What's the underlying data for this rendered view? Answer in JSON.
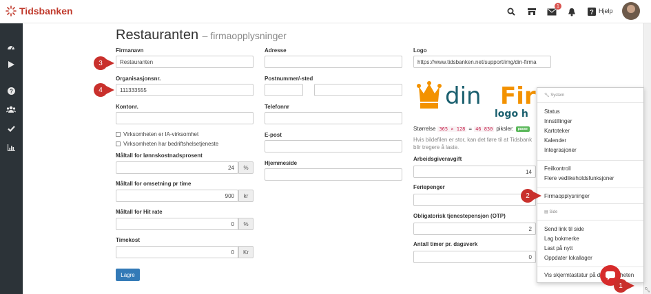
{
  "app": {
    "name": "Tidsbanken"
  },
  "topbar": {
    "help_label": "Hjelp",
    "mail_badge": "1",
    "icons": [
      "search-icon",
      "store-icon",
      "mail-icon",
      "bell-icon",
      "help-icon"
    ]
  },
  "sidebar": {
    "icons": [
      "dashboard-icon",
      "play-icon",
      "question-icon",
      "users-icon",
      "check-icon",
      "chart-icon"
    ]
  },
  "page": {
    "title": "Restauranten",
    "subtitle": "– firmaopplysninger"
  },
  "form": {
    "col1": {
      "firmanavn_label": "Firmanavn",
      "firmanavn_value": "Restauranten",
      "orgnr_label": "Organisasjonsnr.",
      "orgnr_value": "111333555",
      "kontonr_label": "Kontonr.",
      "kontonr_value": "",
      "check_ia": "Virksomheten er IA-virksomhet",
      "check_bht": "Virksomheten har bedriftshelsetjeneste",
      "lonn_label": "Måltall for lønnskostnadsprosent",
      "lonn_value": "24",
      "lonn_unit": "%",
      "oms_label": "Måltall for omsetning pr time",
      "oms_value": "900",
      "oms_unit": "kr",
      "hit_label": "Måltall for Hit rate",
      "hit_value": "0",
      "hit_unit": "%",
      "timekost_label": "Timekost",
      "timekost_value": "0",
      "timekost_unit": "Kr"
    },
    "col2": {
      "adresse_label": "Adresse",
      "post_label": "Postnummer/-sted",
      "telefon_label": "Telefonnr",
      "epost_label": "E-post",
      "hjemmeside_label": "Hjemmeside"
    },
    "col3": {
      "logo_label": "Logo",
      "logo_url": "https://www.tidsbanken.net/support/img/din-firma",
      "logo_text_din": "din",
      "logo_text_firma": "Firma",
      "logo_text_sub": "logo h",
      "size_label": "Størrelse",
      "size_w_h": "365 × 128",
      "size_eq": "=",
      "size_px": "46 830",
      "size_suffix": "piksler:",
      "size_status": "passe",
      "hint": "Hvis bildefilen er stor, kan det føre til at Tidsbank blir tregere å laste.",
      "aga_label": "Arbeidsgiveravgift",
      "aga_value": "14",
      "ferie_label": "Feriepenger",
      "otp_label": "Obligatorisk tjenestepensjon (OTP)",
      "otp_value": "2",
      "timer_label": "Antall timer pr. dagsverk",
      "timer_value": "0"
    },
    "save_label": "Lagre"
  },
  "menu": {
    "system_header": "System",
    "system_items": [
      "Status",
      "Innstillinger",
      "Kartoteker",
      "Kalender",
      "Integrasjoner"
    ],
    "maint_items": [
      "Feilkontroll",
      "Flere vedlikeholdsfunksjoner"
    ],
    "firma_item": "Firmaopplysninger",
    "side_header": "Side",
    "side_items": [
      "Send link til side",
      "Lag bokmerke",
      "Last på nytt",
      "Oppdater lokallager"
    ],
    "keyboard_item": "Vis skjermtastatur på denne enheten"
  },
  "markers": [
    "1",
    "2",
    "3",
    "4"
  ],
  "colors": {
    "brand": "#c0392b",
    "primary": "#337ab7",
    "marker": "#c9302c",
    "sidebar": "#2c3338"
  }
}
